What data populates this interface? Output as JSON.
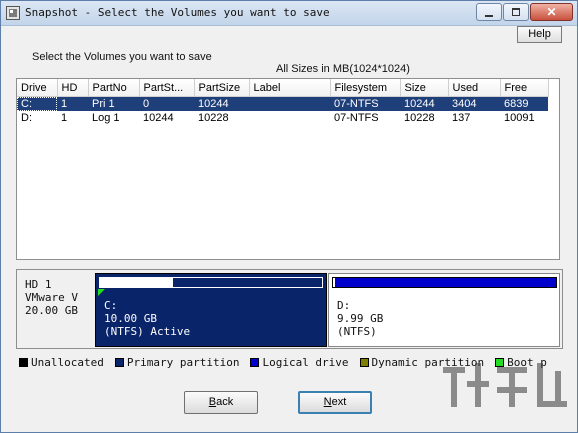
{
  "window": {
    "title": "Snapshot - Select the Volumes you want to save",
    "icon": "app-icon",
    "caption_buttons": [
      "minimize-icon",
      "maximize-icon",
      "close-icon"
    ],
    "close_glyph": "✕"
  },
  "toolbar": {
    "help_label": "Help"
  },
  "main": {
    "instruction": "Select the Volumes you want to save",
    "sizes_note": "All Sizes in MB(1024*1024)"
  },
  "volumes": {
    "columns": [
      "Drive",
      "HD",
      "PartNo",
      "PartSt...",
      "PartSize",
      "Label",
      "Filesystem",
      "Size",
      "Used",
      "Free"
    ],
    "rows": [
      {
        "drive": "C:",
        "hd": "1",
        "partno": "Pri 1",
        "partstart": "0",
        "partsize": "10244",
        "label": "",
        "filesystem": "07-NTFS",
        "size": "10244",
        "used": "3404",
        "free": "6839",
        "selected": true
      },
      {
        "drive": "D:",
        "hd": "1",
        "partno": "Log 1",
        "partstart": "10244",
        "partsize": "10228",
        "label": "",
        "filesystem": "07-NTFS",
        "size": "10228",
        "used": "137",
        "free": "10091",
        "selected": false
      }
    ]
  },
  "disk": {
    "name": "HD 1",
    "model": "VMware V",
    "size": "20.00 GB",
    "partitions": [
      {
        "letter": "C:",
        "size": "10.00 GB",
        "fs": "(NTFS) Active",
        "used_fraction": 0.33,
        "type": "Primary partition",
        "boot": true
      },
      {
        "letter": "D:",
        "size": "9.99 GB",
        "fs": "(NTFS)",
        "used_fraction": 0.01,
        "type": "Logical drive",
        "boot": false
      }
    ]
  },
  "legend": [
    {
      "label": "Unallocated",
      "color": "#000000"
    },
    {
      "label": "Primary partition",
      "color": "#0a246a"
    },
    {
      "label": "Logical drive",
      "color": "#0000cc"
    },
    {
      "label": "Dynamic partition",
      "color": "#808000"
    },
    {
      "label": "Boot p",
      "color": "#22dd22"
    }
  ],
  "footer": {
    "back_label": "Back",
    "next_label": "Next",
    "back_mnemonic": "B",
    "next_mnemonic": "N"
  },
  "colors": {
    "selection": "#1f3f7a",
    "primary_partition": "#0a246a",
    "logical_drive": "#0000cc",
    "boot_flag": "#22dd22"
  }
}
